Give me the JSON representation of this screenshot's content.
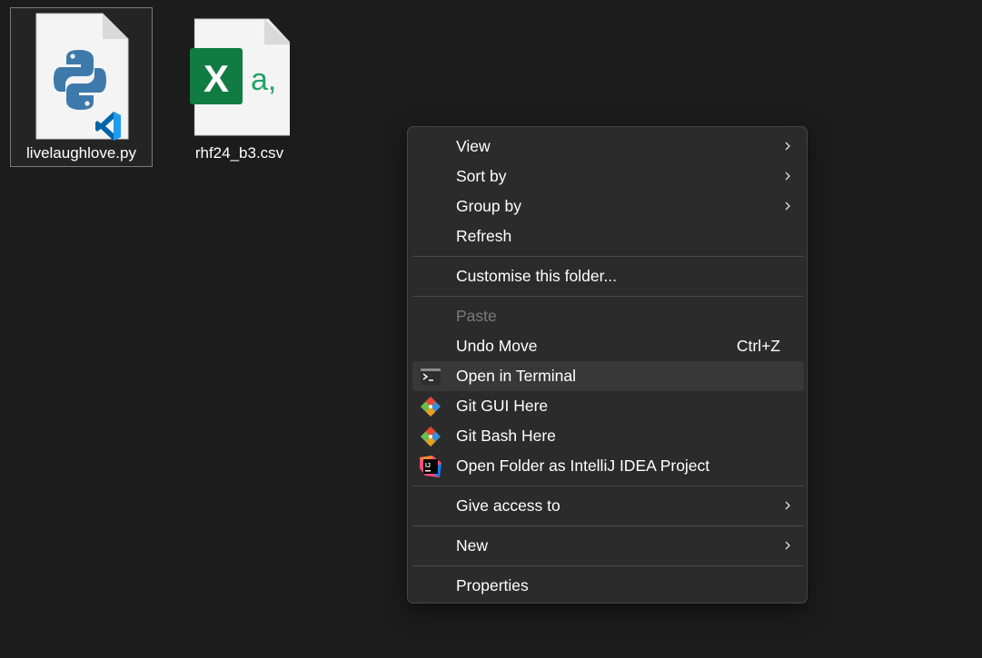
{
  "files": [
    {
      "name": "livelaughlove.py",
      "icon": "python-file-icon",
      "selected": true
    },
    {
      "name": "rhf24_b3.csv",
      "icon": "excel-csv-file-icon",
      "selected": false
    }
  ],
  "menu": {
    "items": [
      {
        "label": "View",
        "submenu": true
      },
      {
        "label": "Sort by",
        "submenu": true
      },
      {
        "label": "Group by",
        "submenu": true
      },
      {
        "label": "Refresh"
      },
      {
        "label": "Customise this folder..."
      },
      {
        "label": "Paste",
        "disabled": true
      },
      {
        "label": "Undo Move",
        "shortcut": "Ctrl+Z"
      },
      {
        "label": "Open in Terminal",
        "icon": "terminal-icon",
        "hovered": true
      },
      {
        "label": "Git GUI Here",
        "icon": "git-gui-icon"
      },
      {
        "label": "Git Bash Here",
        "icon": "git-bash-icon"
      },
      {
        "label": "Open Folder as IntelliJ IDEA Project",
        "icon": "intellij-idea-icon"
      },
      {
        "label": "Give access to",
        "submenu": true
      },
      {
        "label": "New",
        "submenu": true
      },
      {
        "label": "Properties"
      }
    ]
  },
  "colors": {
    "background": "#1c1c1c",
    "menu_background": "#2b2b2b",
    "hover": "#383838",
    "disabled_text": "#7a7a7a",
    "excel_green": "#107c41",
    "python_blue": "#3d7aab",
    "vscode_blue": "#0065a9"
  }
}
